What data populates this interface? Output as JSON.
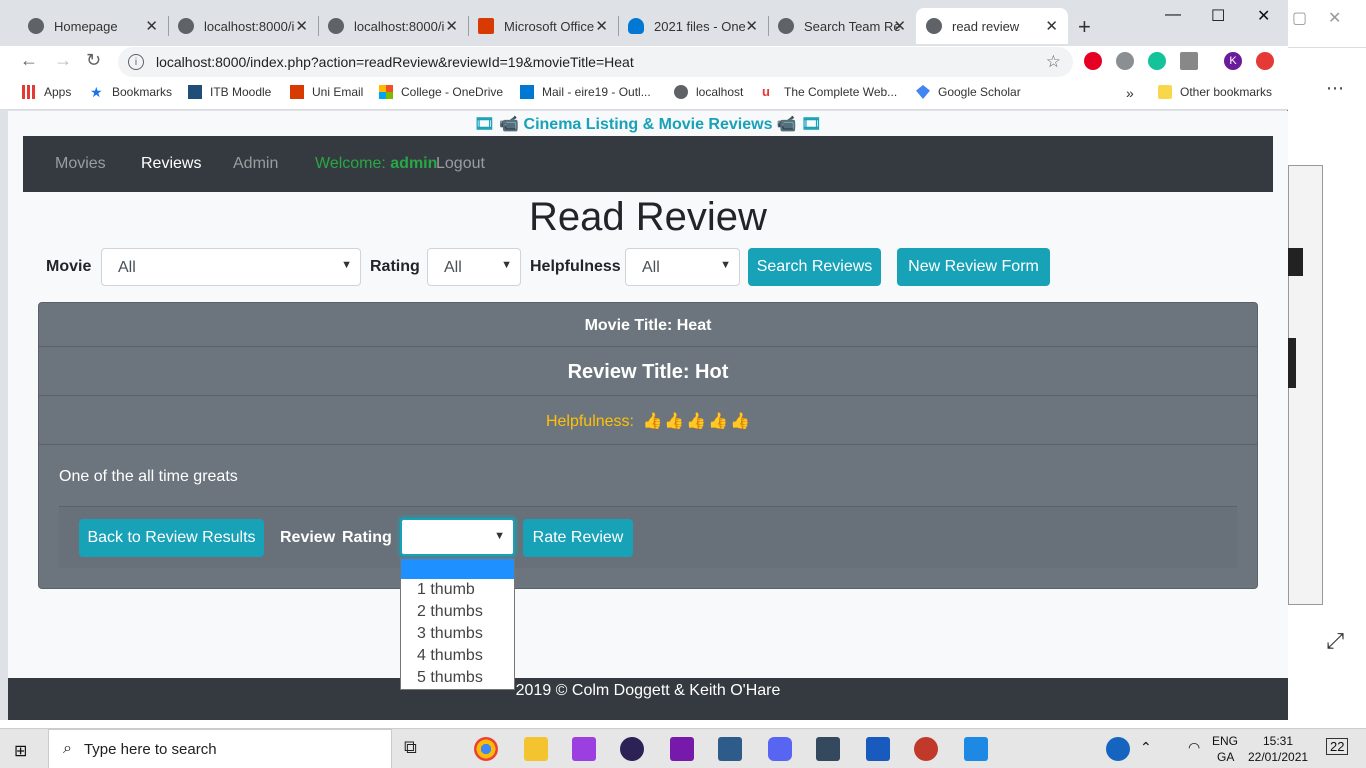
{
  "browser": {
    "tabs": [
      {
        "label": "Homepage",
        "active": false
      },
      {
        "label": "localhost:8000/i",
        "active": false
      },
      {
        "label": "localhost:8000/i",
        "active": false
      },
      {
        "label": "Microsoft Office",
        "active": false
      },
      {
        "label": "2021 files - One",
        "active": false
      },
      {
        "label": "Search Team Re",
        "active": false
      },
      {
        "label": "read review",
        "active": true
      }
    ],
    "url": "localhost:8000/index.php?action=readReview&reviewId=19&movieTitle=Heat",
    "bookmarks": [
      {
        "label": "Apps"
      },
      {
        "label": "Bookmarks"
      },
      {
        "label": "ITB Moodle"
      },
      {
        "label": "Uni Email"
      },
      {
        "label": "College - OneDrive"
      },
      {
        "label": "Mail - eire19 - Outl..."
      },
      {
        "label": "localhost"
      },
      {
        "label": "The Complete Web..."
      },
      {
        "label": "Google Scholar"
      }
    ],
    "other_bookmarks": "Other bookmarks",
    "profile_initial": "K"
  },
  "site": {
    "banner": "🎞 📹 Cinema Listing & Movie Reviews 📹 🎞",
    "nav": {
      "movies": "Movies",
      "reviews": "Reviews",
      "admin": "Admin",
      "welcome_prefix": "Welcome: ",
      "welcome_user": "admin",
      "logout": "Logout"
    },
    "page_title": "Read Review",
    "filters": {
      "movie_label": "Movie",
      "movie_value": "All",
      "rating_label": "Rating",
      "rating_value": "All",
      "helpfulness_label": "Helpfulness",
      "helpfulness_value": "All",
      "search_button": "Search Reviews",
      "new_review_button": "New Review Form"
    },
    "review": {
      "movie_title": "Movie Title: Heat",
      "review_title": "Review Title: Hot",
      "helpfulness_label": "Helpfulness:",
      "helpfulness_thumbs": 5,
      "body": "One of the all time greats"
    },
    "actions": {
      "back_button": "Back to Review Results",
      "rating_label_1": "Review",
      "rating_label_2": "Rating",
      "rate_button": "Rate Review",
      "rating_options": [
        "",
        "1 thumb",
        "2 thumbs",
        "3 thumbs",
        "4 thumbs",
        "5 thumbs"
      ]
    },
    "footer": "2019 © Colm Doggett & Keith O'Hare"
  },
  "taskbar": {
    "search_placeholder": "Type here to search",
    "lang_1": "ENG",
    "lang_2": "GA",
    "time": "15:31",
    "date": "22/01/2021",
    "notifications": "22"
  },
  "colors": {
    "accent": "#17a2b8",
    "navbar": "#343a40",
    "card": "#6c757d",
    "welcome": "#28a745",
    "helpfulness": "#ffc107"
  }
}
